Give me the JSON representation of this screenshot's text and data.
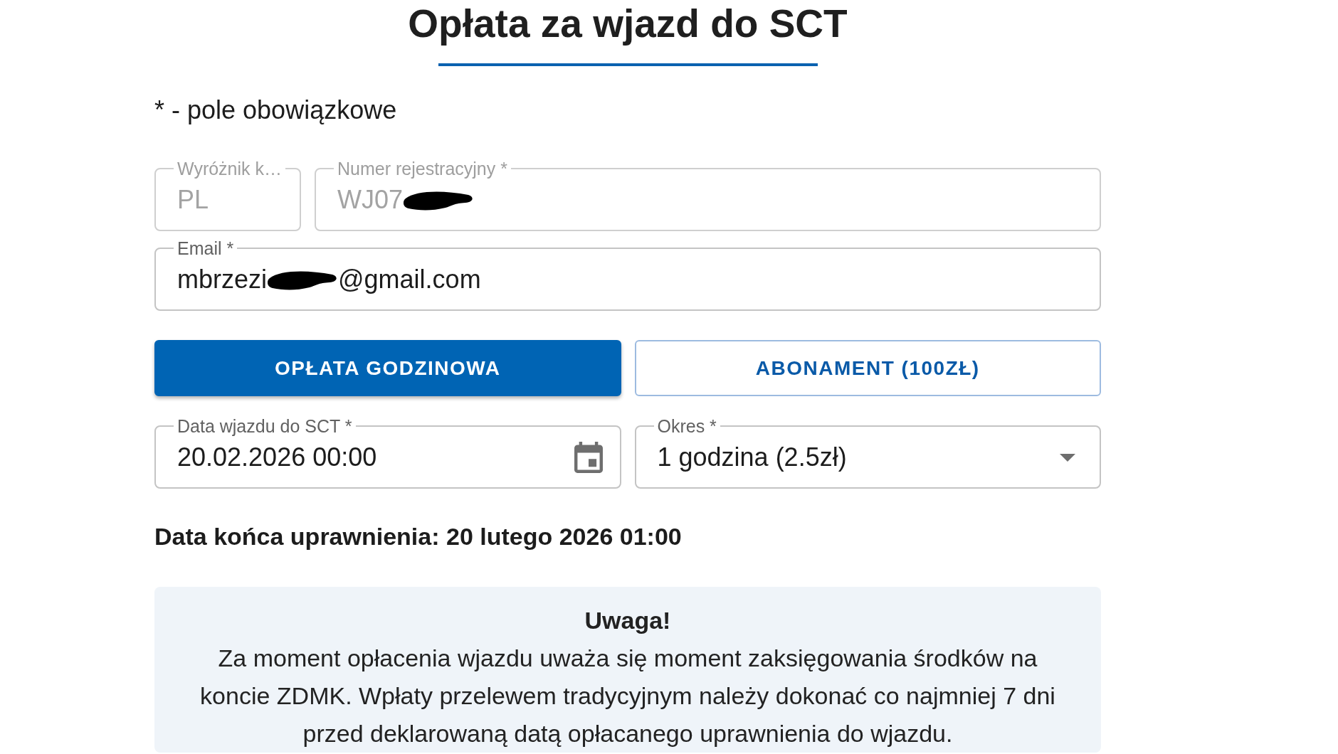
{
  "title": "Opłata za wjazd do SCT",
  "required_note": "* - pole obowiązkowe",
  "field_rows": [
    [
      {
        "kind": "text",
        "label": "Wyróżnik k…",
        "disabled": true,
        "segments": [
          {
            "kind": "text",
            "text": "PL"
          }
        ]
      },
      {
        "kind": "text",
        "label": "Numer rejestracyjny *",
        "disabled": true,
        "segments": [
          {
            "kind": "text",
            "text": "WJ07"
          },
          {
            "kind": "redaction"
          }
        ]
      }
    ],
    [
      {
        "kind": "text",
        "label": "Email *",
        "disabled": false,
        "segments": [
          {
            "kind": "text",
            "text": "mbrzezi"
          },
          {
            "kind": "redaction"
          },
          {
            "kind": "text",
            "text": "@gmail.com"
          }
        ]
      }
    ]
  ],
  "fee_options": [
    {
      "label": "OPŁATA GODZINOWA",
      "selected": true
    },
    {
      "label": "ABONAMENT (100ZŁ)",
      "selected": false
    }
  ],
  "entry_fields": [
    {
      "kind": "date",
      "label": "Data wjazdu do SCT *",
      "disabled": false,
      "segments": [
        {
          "kind": "text",
          "text": "20.02.2026 00:00"
        }
      ]
    },
    {
      "kind": "select",
      "label": "Okres *",
      "disabled": false,
      "segments": [
        {
          "kind": "text",
          "text": "1 godzina (2.5zł)"
        }
      ]
    }
  ],
  "end_date": "Data końca uprawnienia: 20 lutego 2026 01:00",
  "notice": {
    "heading": "Uwaga!",
    "text": "Za moment opłacenia wjazdu uważa się moment zaksięgowania środków na koncie ZDMK. Wpłaty przelewem tradycyjnym należy dokonać co najmniej 7 dni przed deklarowaną datą opłacanego uprawnienia do wjazdu."
  }
}
